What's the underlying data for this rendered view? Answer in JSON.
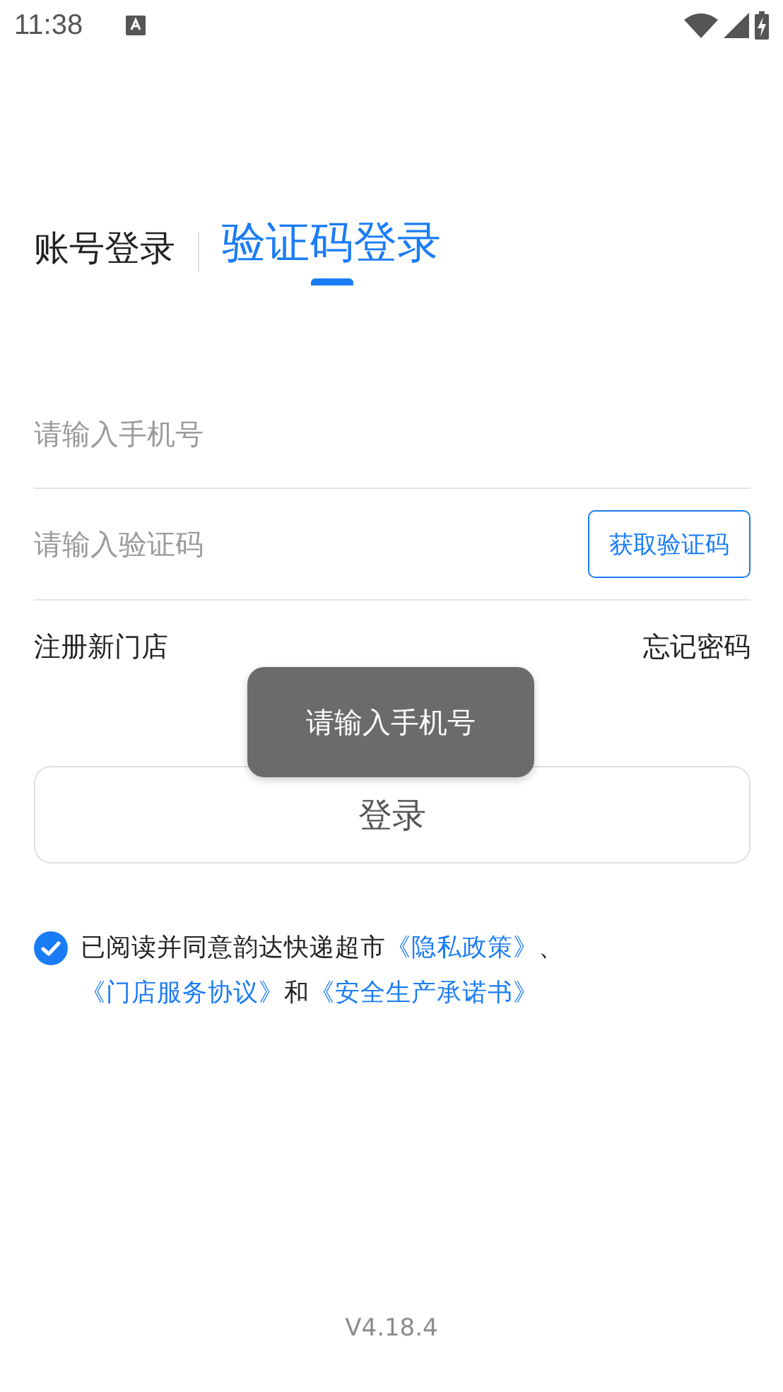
{
  "status_bar": {
    "time": "11:38"
  },
  "tabs": [
    {
      "label": "账号登录",
      "selected": false
    },
    {
      "label": "验证码登录",
      "selected": true
    }
  ],
  "phone_field": {
    "placeholder": "请输入手机号"
  },
  "code_field": {
    "placeholder": "请输入验证码"
  },
  "get_code_button": "获取验证码",
  "register_link": "注册新门店",
  "forgot_link": "忘记密码",
  "toast": "请输入手机号",
  "login_button": "登录",
  "agreement": {
    "checked": true,
    "parts": [
      {
        "kind": "text",
        "text": "已阅读并同意韵达快递超市"
      },
      {
        "kind": "link",
        "text": "《隐私政策》"
      },
      {
        "kind": "text",
        "text": "、 "
      },
      {
        "kind": "link",
        "text": "《门店服务协议》"
      },
      {
        "kind": "text",
        "text": "和"
      },
      {
        "kind": "link",
        "text": "《安全生产承诺书》"
      }
    ]
  },
  "version": "V4.18.4"
}
